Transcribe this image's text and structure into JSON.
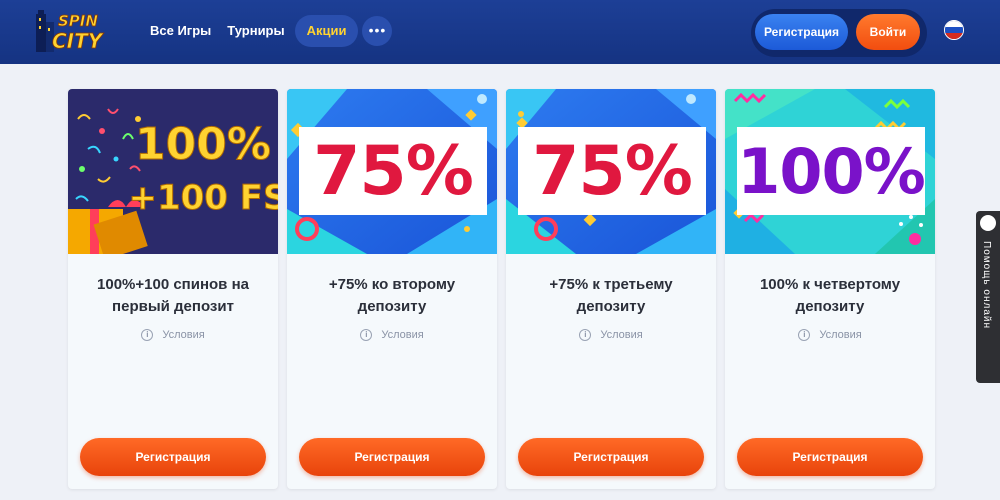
{
  "header": {
    "logo_top": "SPIN",
    "logo_bottom": "CITY",
    "nav": [
      {
        "label": "Все Игры"
      },
      {
        "label": "Турниры"
      },
      {
        "label": "Акции"
      }
    ],
    "more_label": "•••",
    "register_label": "Регистрация",
    "login_label": "Войти",
    "language": "ru"
  },
  "promos": [
    {
      "image_text_line1": "100%",
      "image_text_line2": "+100 FS",
      "title_line1": "100%+100 спинов на",
      "title_line2": "первый депозит",
      "terms_label": "Условия",
      "button_label": "Регистрация"
    },
    {
      "image_text": "75%",
      "image_color": "#e0183f",
      "title_line1": "+75% ко второму",
      "title_line2": "депозиту",
      "terms_label": "Условия",
      "button_label": "Регистрация"
    },
    {
      "image_text": "75%",
      "image_color": "#e0183f",
      "title_line1": "+75% к третьему",
      "title_line2": "депозиту",
      "terms_label": "Условия",
      "button_label": "Регистрация"
    },
    {
      "image_text": "100%",
      "image_color": "#7a12c9",
      "title_line1": "100% к четвертому",
      "title_line2": "депозиту",
      "terms_label": "Условия",
      "button_label": "Регистрация"
    }
  ],
  "help_tab": {
    "label": "Помощь онлайн"
  },
  "colors": {
    "header_bg": "#1d3f96",
    "accent_orange": "#f24d0f",
    "accent_blue": "#1c5ad8",
    "active_nav_text": "#ffd331"
  }
}
